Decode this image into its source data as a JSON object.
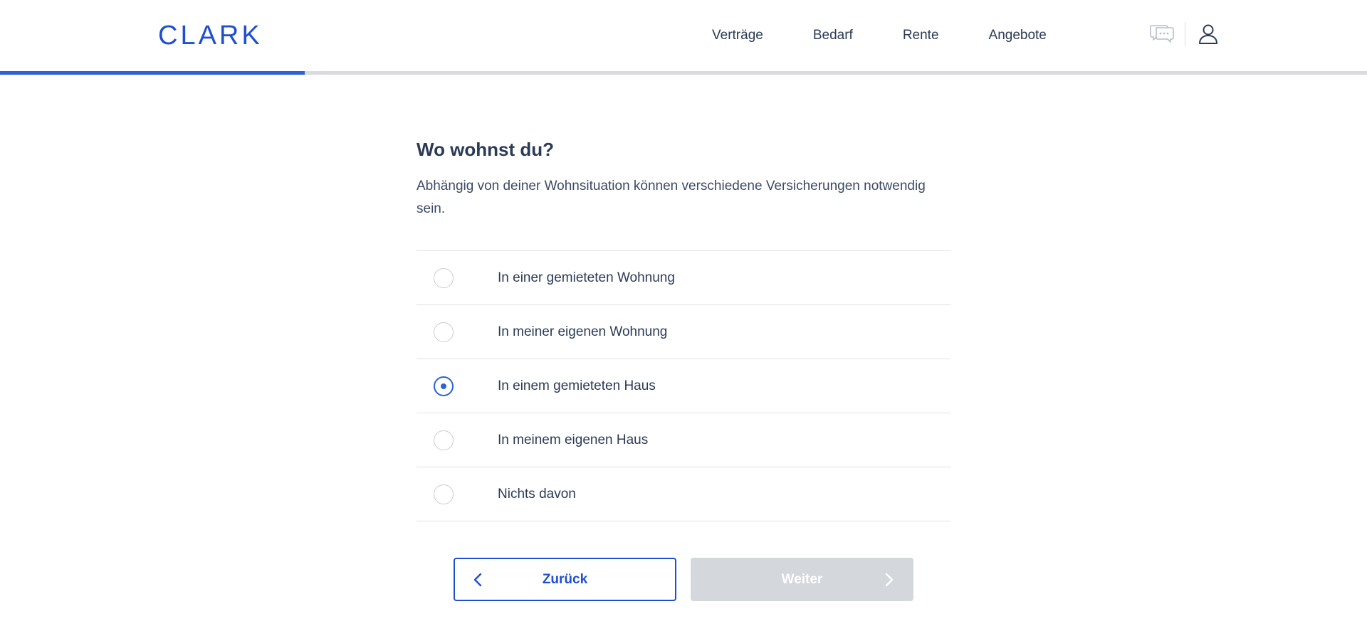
{
  "header": {
    "logo": "CLARK",
    "nav": [
      "Verträge",
      "Bedarf",
      "Rente",
      "Angebote"
    ],
    "icons": [
      "chat-icon",
      "user-icon"
    ]
  },
  "progress": {
    "fraction": 0.223,
    "fill_color": "#2c63d6",
    "track_color": "#d9dbe0"
  },
  "question": {
    "title": "Wo wohnst du?",
    "description": "Abhängig von deiner Wohnsituation können verschiedene Versicherungen notwendig sein.",
    "options": [
      {
        "label": "In einer gemieteten Wohnung",
        "selected": false
      },
      {
        "label": "In meiner eigenen Wohnung",
        "selected": false
      },
      {
        "label": "In einem gemieteten Haus",
        "selected": true
      },
      {
        "label": "In meinem eigenen Haus",
        "selected": false
      },
      {
        "label": "Nichts davon",
        "selected": false
      }
    ]
  },
  "buttons": {
    "back_label": "Zurück",
    "next_label": "Weiter",
    "next_disabled": true
  },
  "colors": {
    "brand": "#1f4fd1",
    "accent": "#2c63d6",
    "text": "#2b3a55",
    "disabled": "#d4d7dc"
  }
}
